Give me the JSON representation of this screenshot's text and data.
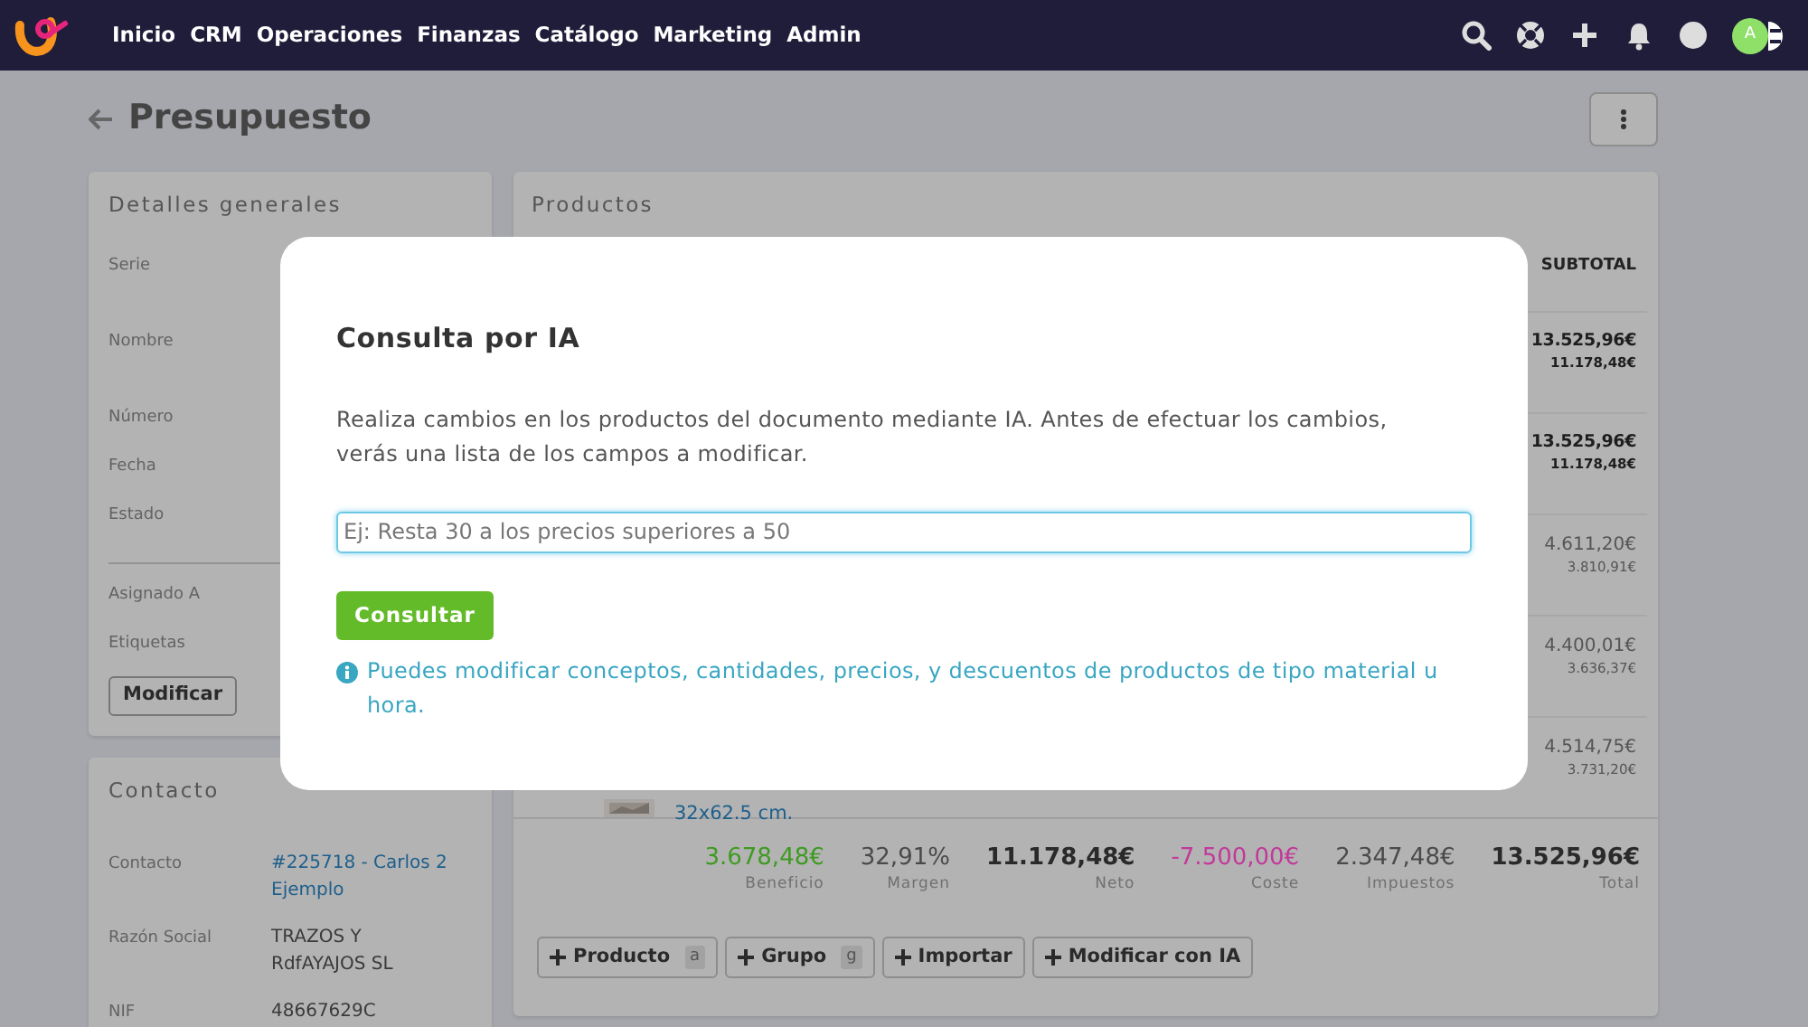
{
  "navbar": {
    "menu": [
      {
        "label": "Inicio"
      },
      {
        "label": "CRM"
      },
      {
        "label": "Operaciones"
      },
      {
        "label": "Finanzas"
      },
      {
        "label": "Catálogo"
      },
      {
        "label": "Marketing"
      },
      {
        "label": "Admin"
      }
    ],
    "avatar": {
      "initial": "A"
    }
  },
  "page": {
    "title": "Presupuesto"
  },
  "details_card": {
    "title": "Detalles generales",
    "fields": [
      {
        "label": "Serie"
      },
      {
        "label": "Nombre"
      },
      {
        "label": "Número"
      },
      {
        "label": "Fecha"
      },
      {
        "label": "Estado"
      }
    ],
    "assignment_fields": [
      {
        "label": "Asignado A"
      },
      {
        "label": "Etiquetas"
      }
    ],
    "button": "Modificar"
  },
  "contact_card": {
    "title": "Contacto",
    "fields": [
      {
        "label": "Contacto",
        "value": "#225718 - Carlos 2 Ejemplo",
        "kind": "link"
      },
      {
        "label": "Razón Social",
        "value": "TRAZOS Y RdfAYAJOS SL",
        "kind": "text"
      },
      {
        "label": "NIF",
        "value": "48667629C",
        "kind": "text"
      }
    ]
  },
  "products_card": {
    "title": "Productos",
    "columns": [
      {
        "label": "SUBTOTAL"
      }
    ],
    "rows": [
      {
        "subtotal": "13.525,96€",
        "subtotal_net": "11.178,48€",
        "emphasis": true
      },
      {
        "subtotal": "13.525,96€",
        "subtotal_net": "11.178,48€",
        "emphasis": true
      },
      {
        "subtotal": "4.611,20€",
        "subtotal_net": "3.810,91€",
        "emphasis": false
      },
      {
        "subtotal": "4.400,01€",
        "subtotal_net": "3.636,37€",
        "emphasis": false
      },
      {
        "subtotal": "4.514,75€",
        "subtotal_net": "3.731,20€",
        "emphasis": false,
        "dimensions": "32x62.5 cm.",
        "kind": "picture"
      }
    ],
    "totals": [
      {
        "value": "3.678,48€",
        "label": "Beneficio",
        "color": "#3f9a22",
        "emphasis": false
      },
      {
        "value": "32,91%",
        "label": "Margen",
        "color": "#4a4a4a",
        "emphasis": false
      },
      {
        "value": "11.178,48€",
        "label": "Neto",
        "color": "#2a2a2a",
        "emphasis": true
      },
      {
        "value": "-7.500,00€",
        "label": "Coste",
        "color": "#c2399a",
        "emphasis": false
      },
      {
        "value": "2.347,48€",
        "label": "Impuestos",
        "color": "#4a4a4a",
        "emphasis": false
      },
      {
        "value": "13.525,96€",
        "label": "Total",
        "color": "#2a2a2a",
        "emphasis": true
      }
    ],
    "actions": [
      {
        "label": "Producto",
        "shortcut": "a"
      },
      {
        "label": "Grupo",
        "shortcut": "g"
      },
      {
        "label": "Importar"
      },
      {
        "label": "Modificar con IA"
      }
    ]
  },
  "modal": {
    "title": "Consulta por IA",
    "description": "Realiza cambios en los productos del documento mediante IA. Antes de efectuar los cambios, verás una lista de los campos a modificar.",
    "input": {
      "placeholder": "Ej: Resta 30 a los precios superiores a 50"
    },
    "button": "Consultar",
    "info": "Puedes modificar conceptos, cantidades, precios, y descuentos de productos de tipo material u hora."
  }
}
